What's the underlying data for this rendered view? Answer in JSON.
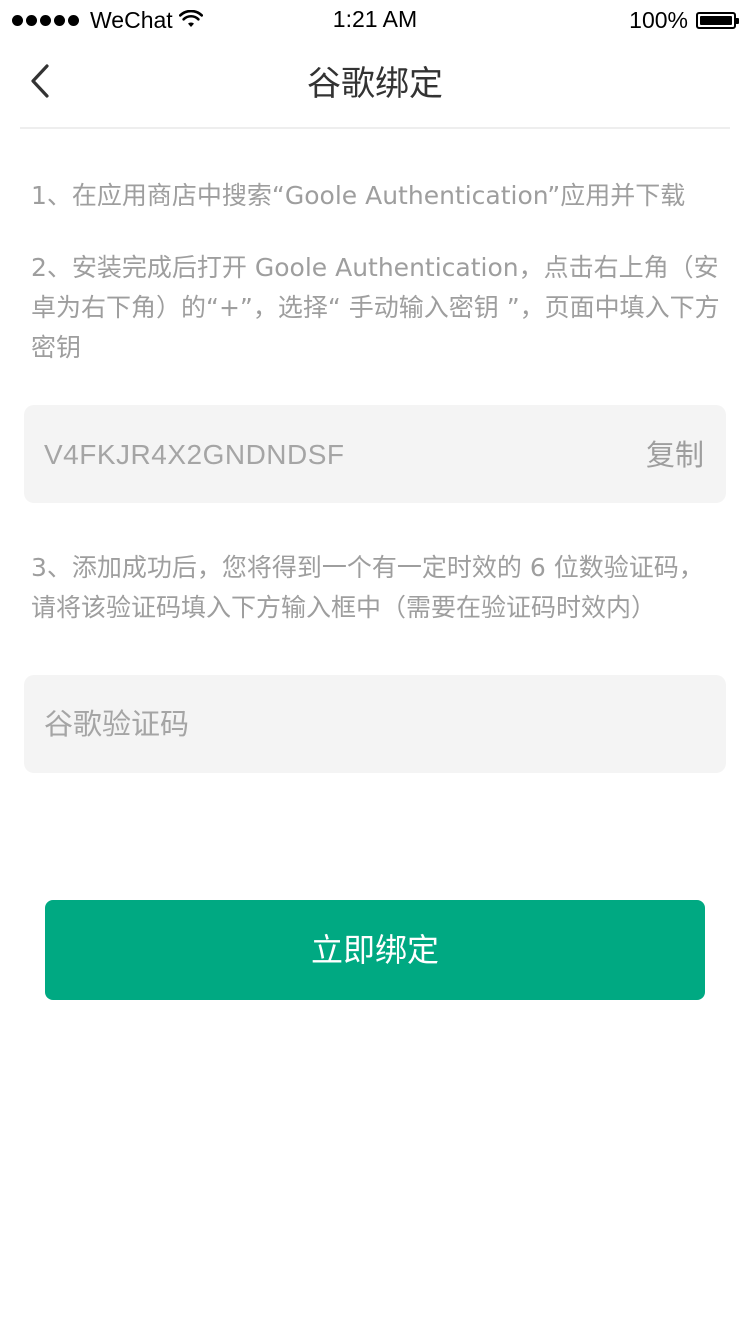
{
  "status_bar": {
    "carrier": "WeChat",
    "time": "1:21 AM",
    "battery": "100%",
    "battery_level": 1.0
  },
  "nav": {
    "title": "谷歌绑定",
    "back_icon": "chevron-left-icon"
  },
  "instructions": {
    "step1": "1、在应用商店中搜索“Goole Authentication”应用并下载",
    "step2": "2、安装完成后打开 Goole Authentication，点击右上角（安卓为右下角）的“+”，选择“ 手动输入密钥 ”，页面中填入下方密钥",
    "step3": "3、添加成功后，您将得到一个有一定时效的 6 位数验证码，请将该验证码填入下方输入框中（需要在验证码时效内）"
  },
  "secret": {
    "key": "V4FKJR4X2GNDNDSF",
    "copy_label": "复制"
  },
  "code_input": {
    "placeholder": "谷歌验证码",
    "value": ""
  },
  "submit": {
    "label": "立即绑定"
  },
  "colors": {
    "accent": "#00a982",
    "input_bg": "#f4f4f4",
    "hint_text": "#9e9e9e"
  }
}
